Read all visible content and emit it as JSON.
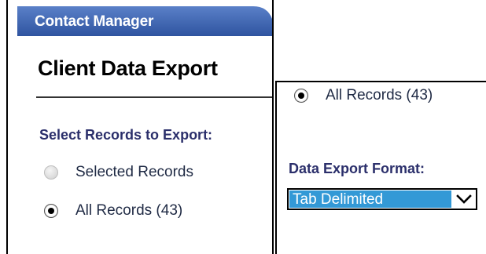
{
  "app": {
    "title": "Contact Manager"
  },
  "page": {
    "title": "Client Data Export"
  },
  "records": {
    "label": "Select Records to Export:",
    "options": [
      {
        "label": "Selected Records",
        "selected": false
      },
      {
        "label": "All Records (43)",
        "selected": true
      }
    ]
  },
  "export_panel": {
    "records_option": {
      "label": "All Records (43)",
      "selected": true
    },
    "format_label": "Data Export Format:",
    "format_select": {
      "value": "Tab Delimited"
    }
  },
  "colors": {
    "header_tab": "#3d63b0",
    "accent_label": "#2b2f6b",
    "select_highlight": "#3399d6"
  },
  "icons": {
    "radio_on": "radio-selected-icon",
    "radio_off": "radio-unselected-icon",
    "dropdown": "chevron-down-icon"
  }
}
